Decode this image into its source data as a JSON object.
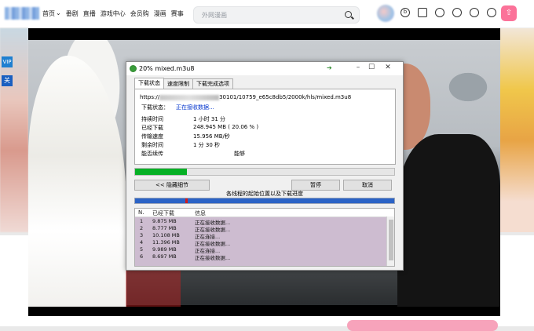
{
  "nav": {
    "links": [
      "首页",
      "番剧",
      "直播",
      "游戏中心",
      "会员购",
      "漫画",
      "赛事"
    ],
    "search_placeholder": "外网漫画"
  },
  "side_badges": [
    "VIP",
    "关"
  ],
  "icons": [
    "search-icon",
    "bilibili-icon",
    "message-icon",
    "dynamic-icon",
    "favorite-icon",
    "history-icon",
    "creation-icon",
    "upload-icon"
  ],
  "dialog": {
    "title": "20% mixed.m3u8",
    "tabs": [
      "下载状态",
      "速度限制",
      "下载完成选项"
    ],
    "url_prefix": "https://",
    "url_suffix": "30101/10759_e65c8db5/2000k/hls/mixed.m3u8",
    "status_label": "下载状态：",
    "status_value": "正在接收数据...",
    "rows": [
      {
        "label": "持续时间",
        "value": "1 小时 31 分"
      },
      {
        "label": "已经下载",
        "value": "248.945 MB ( 20.06 % )"
      },
      {
        "label": "传输速度",
        "value": "15.956 MB/秒"
      },
      {
        "label": "剩余时间",
        "value": "1 分 30 秒"
      },
      {
        "label": "能否续传",
        "value": "能够"
      }
    ],
    "progress": 0.2006,
    "buttons": {
      "hide": "<< 隐藏细节",
      "pause": "暂停",
      "cancel": "取消"
    },
    "segments_label": "各线程的起始位置以及下载进度",
    "table": {
      "headers": [
        "N.",
        "已经下载",
        "信息"
      ],
      "rows": [
        {
          "n": "1",
          "size": "9.875 MB",
          "info": "正在接收数据..."
        },
        {
          "n": "2",
          "size": "8.777 MB",
          "info": "正在接收数据..."
        },
        {
          "n": "3",
          "size": "10.108 MB",
          "info": "正在连接..."
        },
        {
          "n": "4",
          "size": "11.396 MB",
          "info": "正在接收数据..."
        },
        {
          "n": "5",
          "size": "9.989 MB",
          "info": "正在连接..."
        },
        {
          "n": "6",
          "size": "8.697 MB",
          "info": "正在接收数据..."
        }
      ]
    }
  },
  "colors": {
    "accent": "#fb7299",
    "progress": "#06b025",
    "segments": "#2b63c6",
    "link_blue": "#0033cc"
  }
}
